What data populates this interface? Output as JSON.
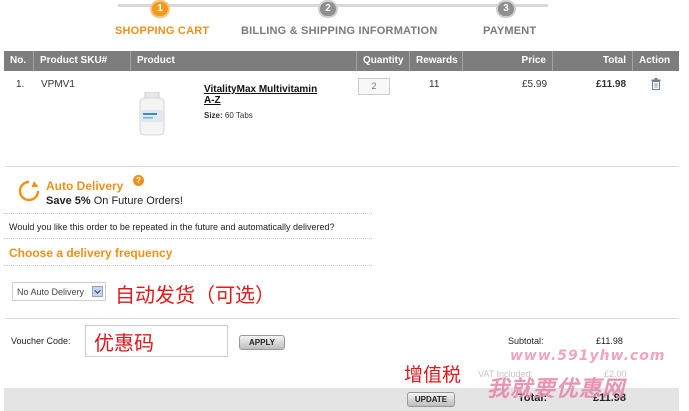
{
  "steps": [
    {
      "num": "1",
      "label": "SHOPPING CART",
      "active": true
    },
    {
      "num": "2",
      "label": "BILLING & SHIPPING INFORMATION",
      "active": false
    },
    {
      "num": "3",
      "label": "PAYMENT",
      "active": false
    }
  ],
  "table": {
    "headers": [
      "No.",
      "Product SKU#",
      "Product",
      "Quantity",
      "Rewards",
      "Price",
      "Total",
      "Action"
    ],
    "rows": [
      {
        "no": "1.",
        "sku": "VPMV1",
        "product_name": "VitalityMax Multivitamin A-Z",
        "size_label": "Size:",
        "size_value": "60 Tabs",
        "quantity": "2",
        "rewards": "11",
        "price": "£5.99",
        "total": "£11.98"
      }
    ]
  },
  "auto_delivery": {
    "title": "Auto Delivery",
    "help_icon": "?",
    "save_strong": "Save 5%",
    "save_rest": "On Future Orders!",
    "question": "Would you like this order to be repeated in the future and automatically delivered?",
    "frequency_heading": "Choose a delivery frequency",
    "frequency_value": "No Auto Delivery"
  },
  "annotations": {
    "auto_delivery_note": "自动发货（可选）",
    "voucher_note": "优惠码",
    "vat_note": "增值税"
  },
  "voucher": {
    "label": "Voucher Code:",
    "apply_label": "APPLY"
  },
  "summary": {
    "subtotal_label": "Subtotal:",
    "subtotal_value": "£11.98",
    "vat_label": "VAT Included:",
    "vat_value": "£2.00",
    "total_label": "Total:",
    "total_value": "£11.98",
    "update_label": "UPDATE"
  },
  "watermark": {
    "url": "www.591yhw.com",
    "name": "我就要优惠网"
  },
  "colors": {
    "accent": "#f0901a",
    "header_bg": "#7d7d7d",
    "annotation_red": "#e0191c"
  }
}
